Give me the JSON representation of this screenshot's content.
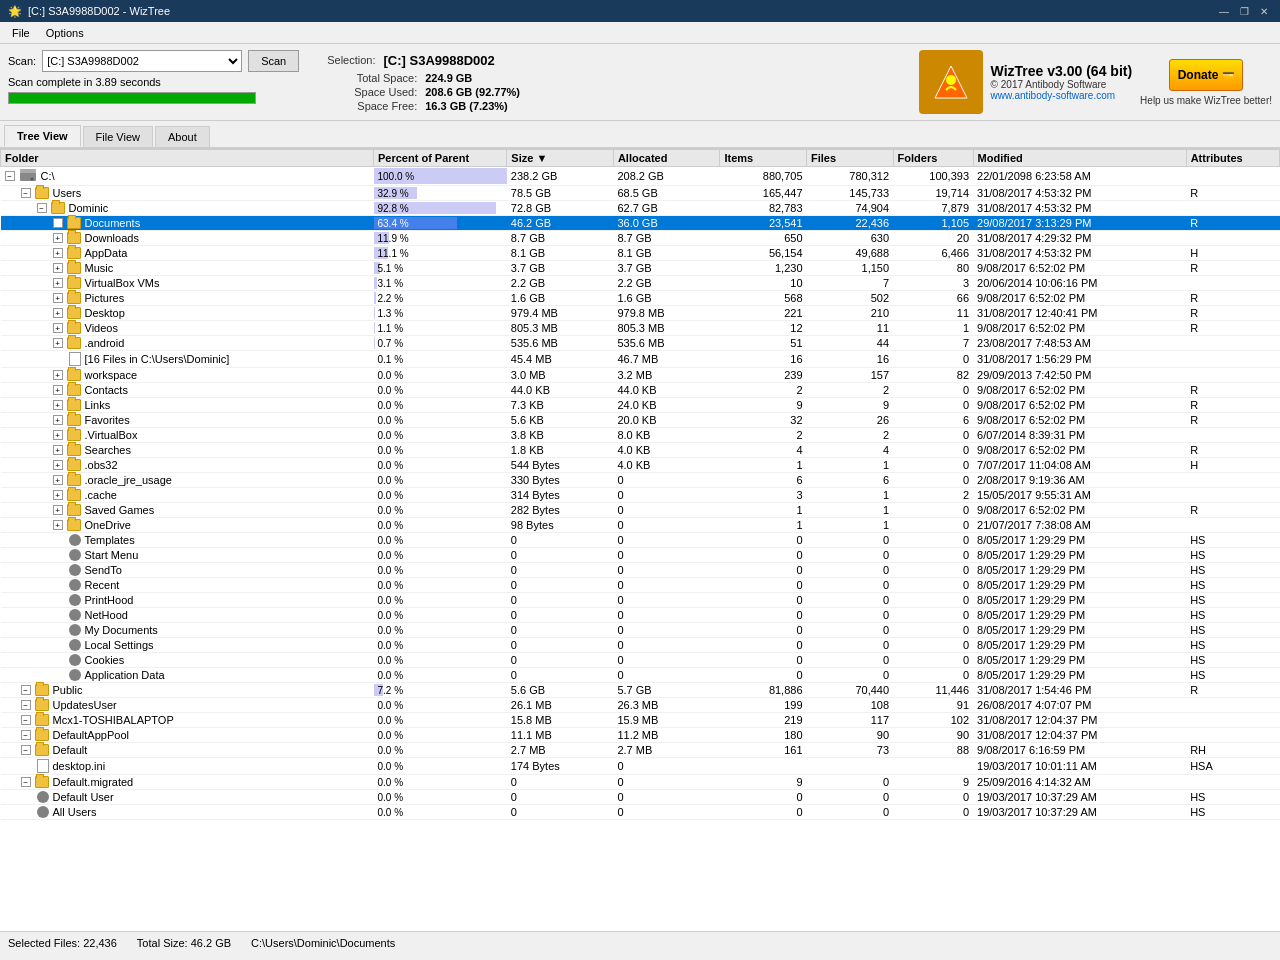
{
  "titleBar": {
    "title": "[C:] S3A9988D002  -  WizTree",
    "controls": [
      "—",
      "❐",
      "✕"
    ]
  },
  "menuBar": {
    "items": [
      "File",
      "Options"
    ]
  },
  "scanArea": {
    "label": "Scan:",
    "driveValue": "[C:] S3A9988D002",
    "scanBtn": "Scan",
    "statusText": "Scan complete in 3.89 seconds",
    "progress": 100
  },
  "selectionInfo": {
    "label": "Selection:",
    "title": "[C:]  S3A9988D002",
    "totalSpaceLabel": "Total Space:",
    "totalSpaceValue": "224.9 GB",
    "spaceUsedLabel": "Space Used:",
    "spaceUsedValue": "208.6 GB  (92.77%)",
    "spaceFreeLabel": "Space Free:",
    "spaceFreeValue": "16.3 GB  (7.23%)"
  },
  "logo": {
    "appName": "WizTree v3.00 (64 bit)",
    "copyright": "© 2017 Antibody Software",
    "url": "www.antibody-software.com",
    "donateText": "Donate",
    "helpText": "Help us make WizTree better!"
  },
  "tabs": [
    "Tree View",
    "File View",
    "About"
  ],
  "activeTab": 0,
  "tableHeaders": [
    "Folder",
    "Percent of Parent",
    "Size ▼",
    "Allocated",
    "Items",
    "Files",
    "Folders",
    "Modified",
    "Attributes"
  ],
  "rows": [
    {
      "indent": 0,
      "expand": true,
      "type": "drive",
      "name": "C:\\",
      "percent": 100.0,
      "percentBar": 100,
      "size": "238.2 GB",
      "allocated": "208.2 GB",
      "items": "880,705",
      "files": "780,312",
      "folders": "100,393",
      "modified": "22/01/2098 6:23:58 AM",
      "attrs": "",
      "selected": false
    },
    {
      "indent": 1,
      "expand": true,
      "type": "folder",
      "name": "Users",
      "percent": 32.9,
      "percentBar": 33,
      "size": "78.5 GB",
      "allocated": "68.5 GB",
      "items": "165,447",
      "files": "145,733",
      "folders": "19,714",
      "modified": "31/08/2017 4:53:32 PM",
      "attrs": "R",
      "selected": false
    },
    {
      "indent": 2,
      "expand": true,
      "type": "folder",
      "name": "Dominic",
      "percent": 92.8,
      "percentBar": 92,
      "size": "72.8 GB",
      "allocated": "62.7 GB",
      "items": "82,783",
      "files": "74,904",
      "folders": "7,879",
      "modified": "31/08/2017 4:53:32 PM",
      "attrs": "",
      "selected": false
    },
    {
      "indent": 3,
      "expand": true,
      "type": "folder",
      "name": "Documents",
      "percent": 63.4,
      "percentBar": 63,
      "size": "46.2 GB",
      "allocated": "36.0 GB",
      "items": "23,541",
      "files": "22,436",
      "folders": "1,105",
      "modified": "29/08/2017 3:13:29 PM",
      "attrs": "R",
      "selected": true
    },
    {
      "indent": 3,
      "expand": true,
      "type": "folder",
      "name": "Downloads",
      "percent": 11.9,
      "percentBar": 12,
      "size": "8.7 GB",
      "allocated": "8.7 GB",
      "items": "650",
      "files": "630",
      "folders": "20",
      "modified": "31/08/2017 4:29:32 PM",
      "attrs": "",
      "selected": false
    },
    {
      "indent": 3,
      "expand": true,
      "type": "folder",
      "name": "AppData",
      "percent": 11.1,
      "percentBar": 11,
      "size": "8.1 GB",
      "allocated": "8.1 GB",
      "items": "56,154",
      "files": "49,688",
      "folders": "6,466",
      "modified": "31/08/2017 4:53:32 PM",
      "attrs": "H",
      "selected": false
    },
    {
      "indent": 3,
      "expand": true,
      "type": "folder",
      "name": "Music",
      "percent": 5.1,
      "percentBar": 5,
      "size": "3.7 GB",
      "allocated": "3.7 GB",
      "items": "1,230",
      "files": "1,150",
      "folders": "80",
      "modified": "9/08/2017 6:52:02 PM",
      "attrs": "R",
      "selected": false
    },
    {
      "indent": 3,
      "expand": true,
      "type": "folder",
      "name": "VirtualBox VMs",
      "percent": 3.1,
      "percentBar": 3,
      "size": "2.2 GB",
      "allocated": "2.2 GB",
      "items": "10",
      "files": "7",
      "folders": "3",
      "modified": "20/06/2014 10:06:16 PM",
      "attrs": "",
      "selected": false
    },
    {
      "indent": 3,
      "expand": true,
      "type": "folder",
      "name": "Pictures",
      "percent": 2.2,
      "percentBar": 2,
      "size": "1.6 GB",
      "allocated": "1.6 GB",
      "items": "568",
      "files": "502",
      "folders": "66",
      "modified": "9/08/2017 6:52:02 PM",
      "attrs": "R",
      "selected": false
    },
    {
      "indent": 3,
      "expand": true,
      "type": "folder",
      "name": "Desktop",
      "percent": 1.3,
      "percentBar": 1,
      "size": "979.4 MB",
      "allocated": "979.8 MB",
      "items": "221",
      "files": "210",
      "folders": "11",
      "modified": "31/08/2017 12:40:41 PM",
      "attrs": "R",
      "selected": false
    },
    {
      "indent": 3,
      "expand": true,
      "type": "folder",
      "name": "Videos",
      "percent": 1.1,
      "percentBar": 1,
      "size": "805.3 MB",
      "allocated": "805.3 MB",
      "items": "12",
      "files": "11",
      "folders": "1",
      "modified": "9/08/2017 6:52:02 PM",
      "attrs": "R",
      "selected": false
    },
    {
      "indent": 3,
      "expand": true,
      "type": "folder",
      "name": ".android",
      "percent": 0.7,
      "percentBar": 1,
      "size": "535.6 MB",
      "allocated": "535.6 MB",
      "items": "51",
      "files": "44",
      "folders": "7",
      "modified": "23/08/2017 7:48:53 AM",
      "attrs": "",
      "selected": false
    },
    {
      "indent": 3,
      "expand": false,
      "type": "file",
      "name": "[16 Files in C:\\Users\\Dominic]",
      "percent": 0.1,
      "percentBar": 0,
      "size": "45.4 MB",
      "allocated": "46.7 MB",
      "items": "16",
      "files": "16",
      "folders": "0",
      "modified": "31/08/2017 1:56:29 PM",
      "attrs": "",
      "selected": false
    },
    {
      "indent": 3,
      "expand": true,
      "type": "folder",
      "name": "workspace",
      "percent": 0.0,
      "percentBar": 0,
      "size": "3.0 MB",
      "allocated": "3.2 MB",
      "items": "239",
      "files": "157",
      "folders": "82",
      "modified": "29/09/2013 7:42:50 PM",
      "attrs": "",
      "selected": false
    },
    {
      "indent": 3,
      "expand": true,
      "type": "folder",
      "name": "Contacts",
      "percent": 0.0,
      "percentBar": 0,
      "size": "44.0 KB",
      "allocated": "44.0 KB",
      "items": "2",
      "files": "2",
      "folders": "0",
      "modified": "9/08/2017 6:52:02 PM",
      "attrs": "R",
      "selected": false
    },
    {
      "indent": 3,
      "expand": true,
      "type": "folder",
      "name": "Links",
      "percent": 0.0,
      "percentBar": 0,
      "size": "7.3 KB",
      "allocated": "24.0 KB",
      "items": "9",
      "files": "9",
      "folders": "0",
      "modified": "9/08/2017 6:52:02 PM",
      "attrs": "R",
      "selected": false
    },
    {
      "indent": 3,
      "expand": true,
      "type": "folder",
      "name": "Favorites",
      "percent": 0.0,
      "percentBar": 0,
      "size": "5.6 KB",
      "allocated": "20.0 KB",
      "items": "32",
      "files": "26",
      "folders": "6",
      "modified": "9/08/2017 6:52:02 PM",
      "attrs": "R",
      "selected": false
    },
    {
      "indent": 3,
      "expand": true,
      "type": "folder",
      "name": ".VirtualBox",
      "percent": 0.0,
      "percentBar": 0,
      "size": "3.8 KB",
      "allocated": "8.0 KB",
      "items": "2",
      "files": "2",
      "folders": "0",
      "modified": "6/07/2014 8:39:31 PM",
      "attrs": "",
      "selected": false
    },
    {
      "indent": 3,
      "expand": true,
      "type": "folder",
      "name": "Searches",
      "percent": 0.0,
      "percentBar": 0,
      "size": "1.8 KB",
      "allocated": "4.0 KB",
      "items": "4",
      "files": "4",
      "folders": "0",
      "modified": "9/08/2017 6:52:02 PM",
      "attrs": "R",
      "selected": false
    },
    {
      "indent": 3,
      "expand": true,
      "type": "folder",
      "name": ".obs32",
      "percent": 0.0,
      "percentBar": 0,
      "size": "544 Bytes",
      "allocated": "4.0 KB",
      "items": "1",
      "files": "1",
      "folders": "0",
      "modified": "7/07/2017 11:04:08 AM",
      "attrs": "H",
      "selected": false
    },
    {
      "indent": 3,
      "expand": true,
      "type": "folder",
      "name": ".oracle_jre_usage",
      "percent": 0.0,
      "percentBar": 0,
      "size": "330 Bytes",
      "allocated": "0",
      "items": "6",
      "files": "6",
      "folders": "0",
      "modified": "2/08/2017 9:19:36 AM",
      "attrs": "",
      "selected": false
    },
    {
      "indent": 3,
      "expand": true,
      "type": "folder",
      "name": ".cache",
      "percent": 0.0,
      "percentBar": 0,
      "size": "314 Bytes",
      "allocated": "0",
      "items": "3",
      "files": "1",
      "folders": "2",
      "modified": "15/05/2017 9:55:31 AM",
      "attrs": "",
      "selected": false
    },
    {
      "indent": 3,
      "expand": true,
      "type": "folder",
      "name": "Saved Games",
      "percent": 0.0,
      "percentBar": 0,
      "size": "282 Bytes",
      "allocated": "0",
      "items": "1",
      "files": "1",
      "folders": "0",
      "modified": "9/08/2017 6:52:02 PM",
      "attrs": "R",
      "selected": false
    },
    {
      "indent": 3,
      "expand": true,
      "type": "folder",
      "name": "OneDrive",
      "percent": 0.0,
      "percentBar": 0,
      "size": "98 Bytes",
      "allocated": "0",
      "items": "1",
      "files": "1",
      "folders": "0",
      "modified": "21/07/2017 7:38:08 AM",
      "attrs": "",
      "selected": false
    },
    {
      "indent": 3,
      "expand": false,
      "type": "settings",
      "name": "Templates",
      "percent": 0.0,
      "percentBar": 0,
      "size": "0",
      "allocated": "0",
      "items": "0",
      "files": "0",
      "folders": "0",
      "modified": "8/05/2017 1:29:29 PM",
      "attrs": "HS",
      "selected": false
    },
    {
      "indent": 3,
      "expand": false,
      "type": "settings",
      "name": "Start Menu",
      "percent": 0.0,
      "percentBar": 0,
      "size": "0",
      "allocated": "0",
      "items": "0",
      "files": "0",
      "folders": "0",
      "modified": "8/05/2017 1:29:29 PM",
      "attrs": "HS",
      "selected": false
    },
    {
      "indent": 3,
      "expand": false,
      "type": "settings",
      "name": "SendTo",
      "percent": 0.0,
      "percentBar": 0,
      "size": "0",
      "allocated": "0",
      "items": "0",
      "files": "0",
      "folders": "0",
      "modified": "8/05/2017 1:29:29 PM",
      "attrs": "HS",
      "selected": false
    },
    {
      "indent": 3,
      "expand": false,
      "type": "settings",
      "name": "Recent",
      "percent": 0.0,
      "percentBar": 0,
      "size": "0",
      "allocated": "0",
      "items": "0",
      "files": "0",
      "folders": "0",
      "modified": "8/05/2017 1:29:29 PM",
      "attrs": "HS",
      "selected": false
    },
    {
      "indent": 3,
      "expand": false,
      "type": "settings",
      "name": "PrintHood",
      "percent": 0.0,
      "percentBar": 0,
      "size": "0",
      "allocated": "0",
      "items": "0",
      "files": "0",
      "folders": "0",
      "modified": "8/05/2017 1:29:29 PM",
      "attrs": "HS",
      "selected": false
    },
    {
      "indent": 3,
      "expand": false,
      "type": "settings",
      "name": "NetHood",
      "percent": 0.0,
      "percentBar": 0,
      "size": "0",
      "allocated": "0",
      "items": "0",
      "files": "0",
      "folders": "0",
      "modified": "8/05/2017 1:29:29 PM",
      "attrs": "HS",
      "selected": false
    },
    {
      "indent": 3,
      "expand": false,
      "type": "settings",
      "name": "My Documents",
      "percent": 0.0,
      "percentBar": 0,
      "size": "0",
      "allocated": "0",
      "items": "0",
      "files": "0",
      "folders": "0",
      "modified": "8/05/2017 1:29:29 PM",
      "attrs": "HS",
      "selected": false
    },
    {
      "indent": 3,
      "expand": false,
      "type": "settings",
      "name": "Local Settings",
      "percent": 0.0,
      "percentBar": 0,
      "size": "0",
      "allocated": "0",
      "items": "0",
      "files": "0",
      "folders": "0",
      "modified": "8/05/2017 1:29:29 PM",
      "attrs": "HS",
      "selected": false
    },
    {
      "indent": 3,
      "expand": false,
      "type": "settings",
      "name": "Cookies",
      "percent": 0.0,
      "percentBar": 0,
      "size": "0",
      "allocated": "0",
      "items": "0",
      "files": "0",
      "folders": "0",
      "modified": "8/05/2017 1:29:29 PM",
      "attrs": "HS",
      "selected": false
    },
    {
      "indent": 3,
      "expand": false,
      "type": "settings",
      "name": "Application Data",
      "percent": 0.0,
      "percentBar": 0,
      "size": "0",
      "allocated": "0",
      "items": "0",
      "files": "0",
      "folders": "0",
      "modified": "8/05/2017 1:29:29 PM",
      "attrs": "HS",
      "selected": false
    },
    {
      "indent": 1,
      "expand": true,
      "type": "folder",
      "name": "Public",
      "percent": 7.2,
      "percentBar": 7,
      "size": "5.6 GB",
      "allocated": "5.7 GB",
      "items": "81,886",
      "files": "70,440",
      "folders": "11,446",
      "modified": "31/08/2017 1:54:46 PM",
      "attrs": "R",
      "selected": false
    },
    {
      "indent": 1,
      "expand": true,
      "type": "folder",
      "name": "UpdatesUser",
      "percent": 0.0,
      "percentBar": 0,
      "size": "26.1 MB",
      "allocated": "26.3 MB",
      "items": "199",
      "files": "108",
      "folders": "91",
      "modified": "26/08/2017 4:07:07 PM",
      "attrs": "",
      "selected": false
    },
    {
      "indent": 1,
      "expand": true,
      "type": "folder",
      "name": "Mcx1-TOSHIBALAPTOP",
      "percent": 0.0,
      "percentBar": 0,
      "size": "15.8 MB",
      "allocated": "15.9 MB",
      "items": "219",
      "files": "117",
      "folders": "102",
      "modified": "31/08/2017 12:04:37 PM",
      "attrs": "",
      "selected": false
    },
    {
      "indent": 1,
      "expand": true,
      "type": "folder",
      "name": "DefaultAppPool",
      "percent": 0.0,
      "percentBar": 0,
      "size": "11.1 MB",
      "allocated": "11.2 MB",
      "items": "180",
      "files": "90",
      "folders": "90",
      "modified": "31/08/2017 12:04:37 PM",
      "attrs": "",
      "selected": false
    },
    {
      "indent": 1,
      "expand": true,
      "type": "folder",
      "name": "Default",
      "percent": 0.0,
      "percentBar": 0,
      "size": "2.7 MB",
      "allocated": "2.7 MB",
      "items": "161",
      "files": "73",
      "folders": "88",
      "modified": "9/08/2017 6:16:59 PM",
      "attrs": "RH",
      "selected": false
    },
    {
      "indent": 1,
      "expand": false,
      "type": "file",
      "name": "desktop.ini",
      "percent": 0.0,
      "percentBar": 0,
      "size": "174 Bytes",
      "allocated": "0",
      "items": "",
      "files": "",
      "folders": "",
      "modified": "19/03/2017 10:01:11 AM",
      "attrs": "HSA",
      "selected": false
    },
    {
      "indent": 1,
      "expand": true,
      "type": "folder",
      "name": "Default.migrated",
      "percent": 0.0,
      "percentBar": 0,
      "size": "0",
      "allocated": "0",
      "items": "9",
      "files": "0",
      "folders": "9",
      "modified": "25/09/2016 4:14:32 AM",
      "attrs": "",
      "selected": false
    },
    {
      "indent": 1,
      "expand": false,
      "type": "settings",
      "name": "Default User",
      "percent": 0.0,
      "percentBar": 0,
      "size": "0",
      "allocated": "0",
      "items": "0",
      "files": "0",
      "folders": "0",
      "modified": "19/03/2017 10:37:29 AM",
      "attrs": "HS",
      "selected": false
    },
    {
      "indent": 1,
      "expand": false,
      "type": "settings",
      "name": "All Users",
      "percent": 0.0,
      "percentBar": 0,
      "size": "0",
      "allocated": "0",
      "items": "0",
      "files": "0",
      "folders": "0",
      "modified": "19/03/2017 10:37:29 AM",
      "attrs": "HS",
      "selected": false
    }
  ],
  "statusBar": {
    "selectedFiles": "Selected Files: 22,436",
    "totalSize": "Total Size: 46.2 GB",
    "path": "C:\\Users\\Dominic\\Documents"
  }
}
